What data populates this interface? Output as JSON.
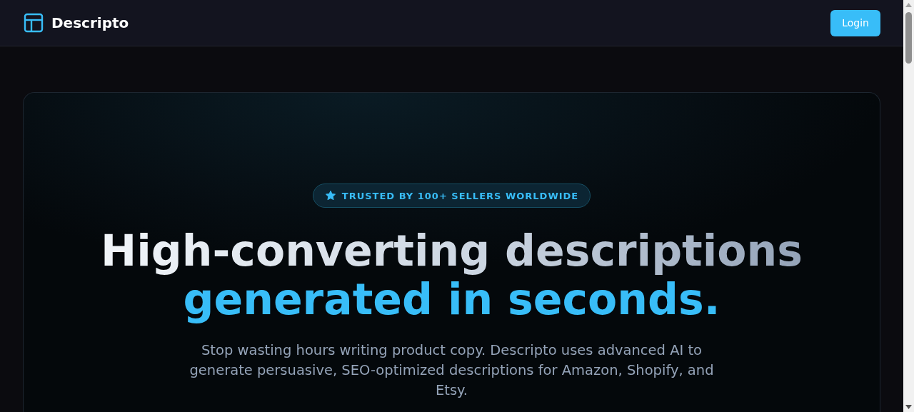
{
  "header": {
    "brand": "Descripto",
    "login_button": "Login"
  },
  "hero": {
    "badge": "TRUSTED BY 100+ SELLERS WORLDWIDE",
    "heading_line_1": "High-converting descriptions",
    "heading_line_2": "generated in seconds.",
    "subtitle": "Stop wasting hours writing product copy. Descripto uses advanced AI to generate persuasive, SEO-optimized descriptions for Amazon, Shopify, and Etsy."
  }
}
